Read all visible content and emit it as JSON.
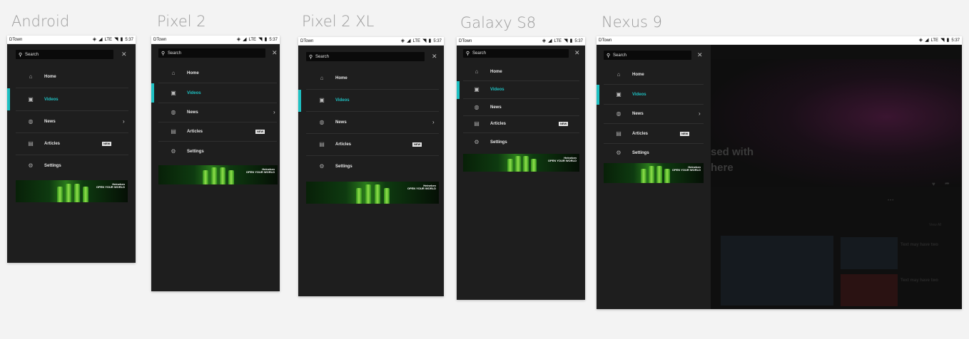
{
  "devices": [
    {
      "title": "Android"
    },
    {
      "title": "Pixel 2"
    },
    {
      "title": "Pixel 2 XL"
    },
    {
      "title": "Galaxy S8"
    },
    {
      "title": "Nexus 9"
    }
  ],
  "statusbar": {
    "app": "DTown",
    "time": "5:37",
    "network": "LTE"
  },
  "search": {
    "placeholder": "Search"
  },
  "menu": {
    "home": "Home",
    "videos": "Videos",
    "news": "News",
    "articles": "Articles",
    "settings": "Settings",
    "new_badge": "NEW"
  },
  "ad": {
    "brand": "Heineken",
    "tagline": "OPEN YOUR WORLD"
  },
  "tablet_bg": {
    "hero_line1": "sed with",
    "hero_line2": "here",
    "view_all": "View All",
    "item1_title": "Text may have two",
    "item2_title": "Text may have two"
  },
  "colors": {
    "accent": "#1ec0c2",
    "drawer": "#1e1e1e",
    "badge": "#e6e6e6"
  }
}
